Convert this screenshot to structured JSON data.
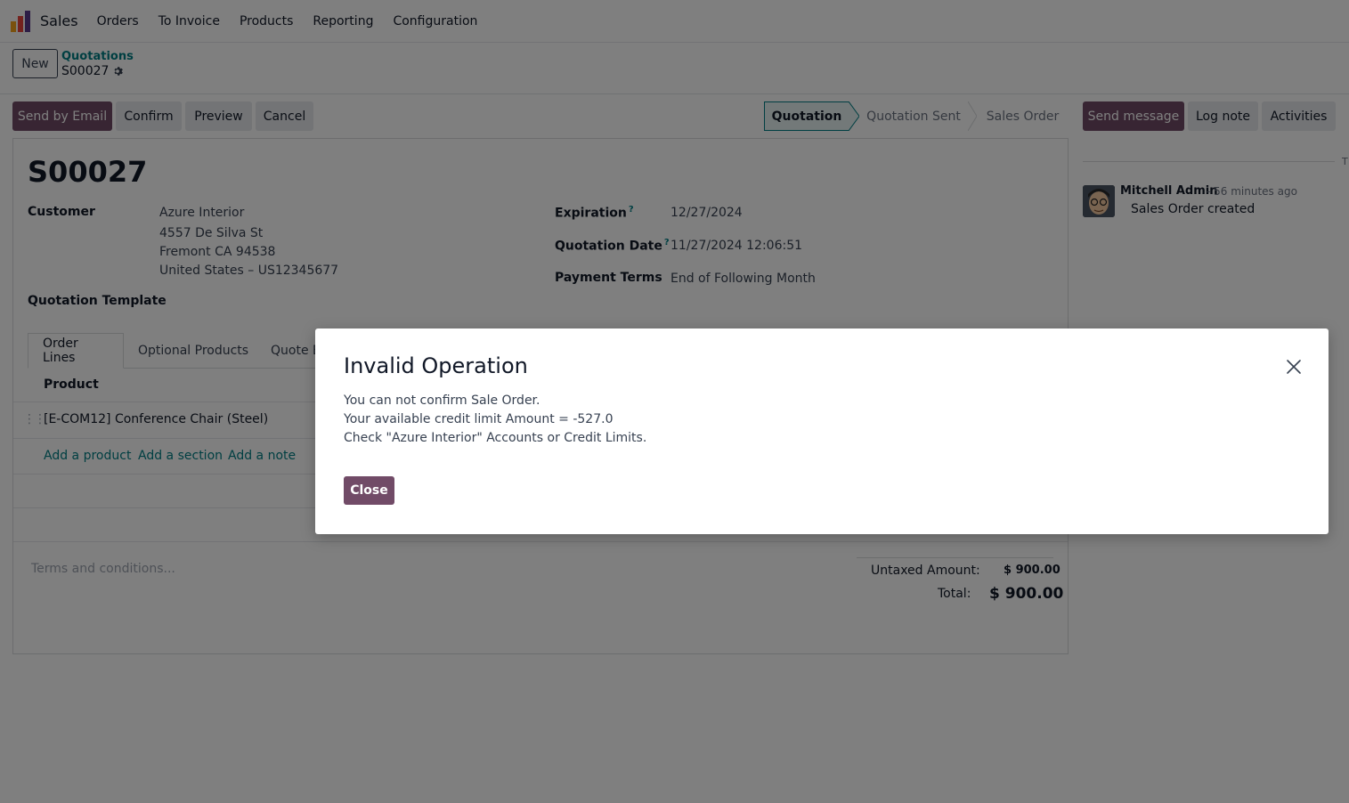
{
  "navbar": {
    "app_name": "Sales",
    "menu": [
      "Orders",
      "To Invoice",
      "Products",
      "Reporting",
      "Configuration"
    ]
  },
  "control_panel": {
    "new_label": "New",
    "breadcrumb_parent": "Quotations",
    "breadcrumb_current": "S00027"
  },
  "actions": {
    "send_by_email": "Send by Email",
    "confirm": "Confirm",
    "preview": "Preview",
    "cancel": "Cancel"
  },
  "statusbar": {
    "stages": [
      "Quotation",
      "Quotation Sent",
      "Sales Order"
    ],
    "active": "Quotation"
  },
  "chatter_buttons": {
    "send_message": "Send message",
    "log_note": "Log note",
    "activities": "Activities",
    "cut_off_label": "T"
  },
  "form": {
    "name": "S00027",
    "customer_label": "Customer",
    "customer_name": "Azure Interior",
    "customer_address": [
      "4557 De Silva St",
      "Fremont CA 94538",
      "United States – US12345677"
    ],
    "quotation_template_label": "Quotation Template",
    "expiration_label": "Expiration",
    "expiration_value": "12/27/2024",
    "quotation_date_label": "Quotation Date",
    "quotation_date_value": "11/27/2024 12:06:51",
    "payment_terms_label": "Payment Terms",
    "payment_terms_value": "End of Following Month",
    "help_marker": "?",
    "tabs": [
      "Order Lines",
      "Optional Products",
      "Quote B"
    ],
    "table_header_product": "Product",
    "lines": [
      {
        "product": "[E-COM12] Conference Chair (Steel)"
      }
    ],
    "add_product": "Add a product",
    "add_section": "Add a section",
    "add_note": "Add a note",
    "terms_placeholder": "Terms and conditions...",
    "untaxed_label": "Untaxed Amount:",
    "untaxed_value": "$ 900.00",
    "total_label": "Total:",
    "total_value": "$ 900.00"
  },
  "chatter": {
    "author": "Mitchell Admin",
    "time": "- 56 minutes ago",
    "message": "Sales Order created"
  },
  "dialog": {
    "title": "Invalid Operation",
    "lines": [
      "You can not confirm Sale Order.",
      "Your available credit limit Amount = -527.0",
      "Check \"Azure Interior\" Accounts or Credit Limits."
    ],
    "close_label": "Close"
  },
  "colors": {
    "brand": "#714b67",
    "link": "#017e84"
  }
}
